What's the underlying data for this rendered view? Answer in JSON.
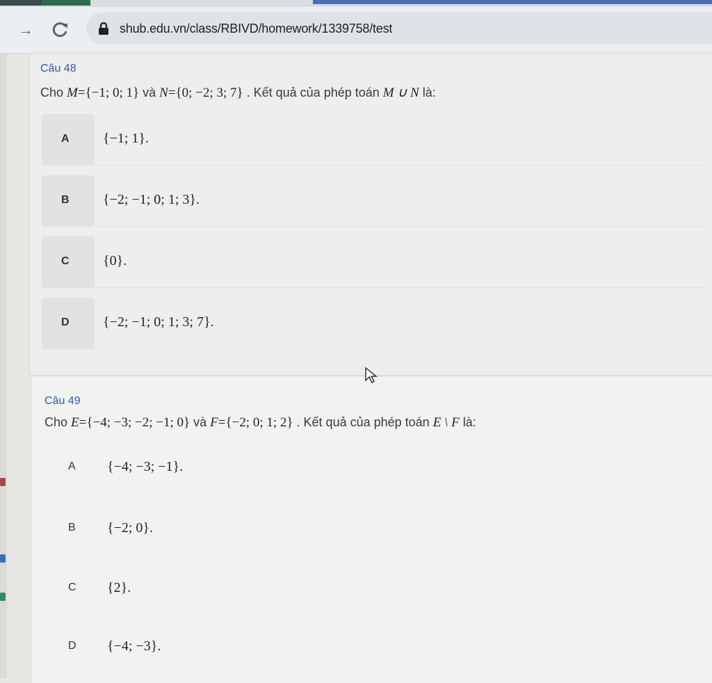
{
  "browser": {
    "url": "shub.edu.vn/class/RBIVD/homework/1339758/test"
  },
  "q48": {
    "head": "Câu 48",
    "text_cho": "Cho",
    "M": "M",
    "M_set": "={−1; 0; 1}",
    "va": "và",
    "N": "N",
    "N_set": "={0; −2; 3; 7}",
    "text_ketqua": ". Kết quả của phép toán",
    "op": "M ∪ N",
    "la": "là:",
    "options": [
      {
        "letter": "A",
        "value": "{−1; 1}."
      },
      {
        "letter": "B",
        "value": "{−2; −1; 0; 1; 3}."
      },
      {
        "letter": "C",
        "value": "{0}."
      },
      {
        "letter": "D",
        "value": "{−2; −1; 0; 1; 3; 7}."
      }
    ]
  },
  "q49": {
    "head": "Câu 49",
    "text_cho": "Cho",
    "E": "E",
    "E_set": "={−4; −3; −2; −1; 0}",
    "va": "và",
    "F": "F",
    "F_set": "={−2; 0; 1; 2}",
    "text_ketqua": ". Kết quả của phép toán",
    "op": "E \\ F",
    "la": "là:",
    "options": [
      {
        "letter": "A",
        "value": "{−4; −3; −1}."
      },
      {
        "letter": "B",
        "value": "{−2; 0}."
      },
      {
        "letter": "C",
        "value": "{2}."
      },
      {
        "letter": "D",
        "value": "{−4; −3}."
      }
    ]
  }
}
